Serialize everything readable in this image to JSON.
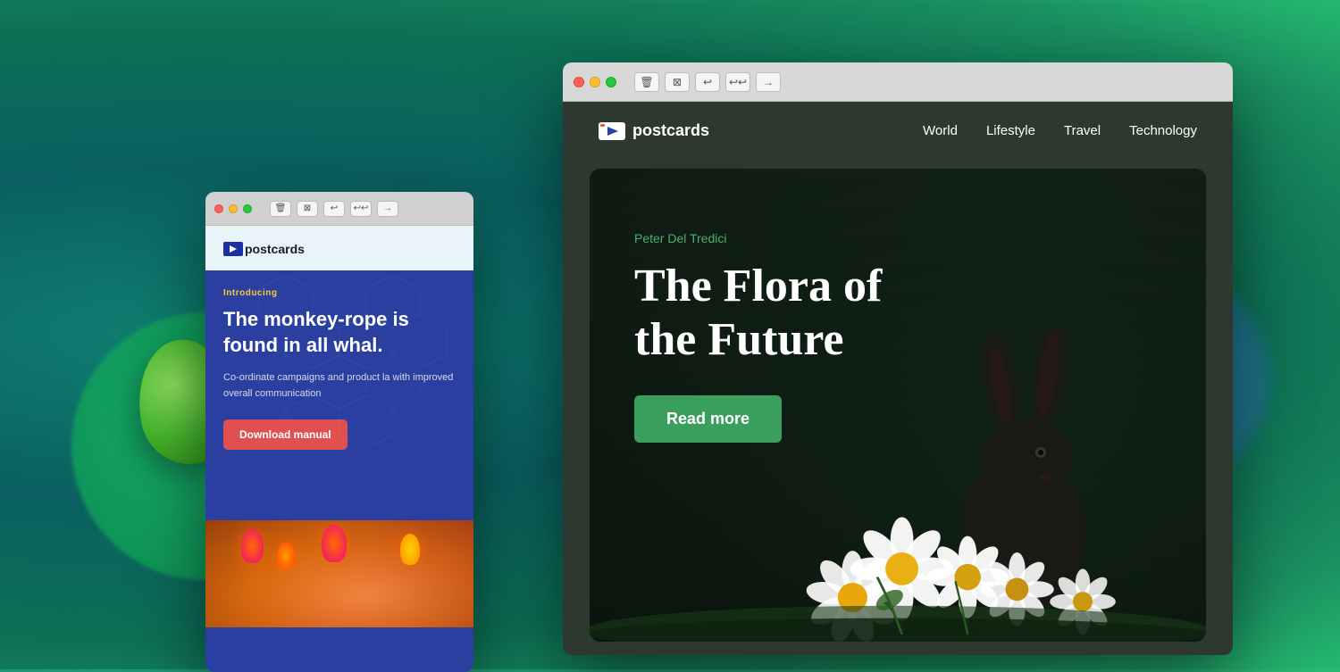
{
  "background": {
    "gradient": "teal-green"
  },
  "window_back": {
    "titlebar": {
      "traffic_lights": [
        "red",
        "yellow",
        "green"
      ],
      "buttons": [
        "trash",
        "trash-alt",
        "back",
        "back-all",
        "forward"
      ]
    },
    "logo": "postcards",
    "section": {
      "label": "Introducing",
      "title": "The monkey-rope is found in all whal.",
      "description": "Co-ordinate campaigns and product la with improved overall communication",
      "button_label": "Download manual"
    }
  },
  "window_front": {
    "titlebar": {
      "traffic_lights": [
        "red",
        "yellow",
        "green"
      ],
      "buttons": [
        "trash",
        "trash-alt",
        "back",
        "back-all",
        "forward"
      ]
    },
    "navbar": {
      "logo": "postcards",
      "links": [
        "World",
        "Lifestyle",
        "Travel",
        "Technology"
      ]
    },
    "hero": {
      "author": "Peter Del Tredici",
      "title_line1": "The Flora of",
      "title_line2": "the Future",
      "button_label": "Read more"
    }
  }
}
